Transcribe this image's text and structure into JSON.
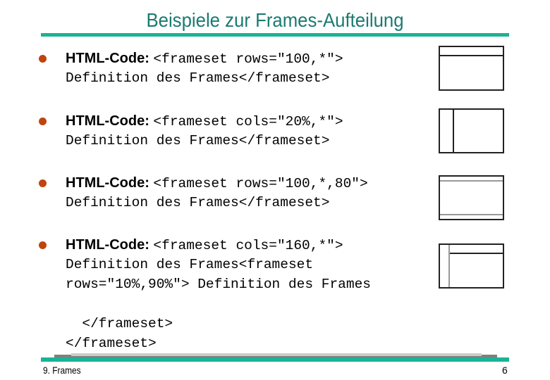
{
  "title": "Beispiele zur Frames-Aufteilung",
  "items": [
    {
      "label": "HTML-Code:",
      "code": "<frameset rows=\"100,*\">",
      "continuation": [
        "Definition des Frames</frameset>"
      ],
      "diagram": "rows-100-star"
    },
    {
      "label": "HTML-Code:",
      "code": "<frameset cols=\"20%,*\">",
      "continuation": [
        "Definition des Frames</frameset>"
      ],
      "diagram": "cols-20pct-star"
    },
    {
      "label": "HTML-Code:",
      "code": "<frameset rows=\"100,*,80\">",
      "continuation": [
        "Definition des Frames</frameset>"
      ],
      "diagram": "rows-100-star-80"
    },
    {
      "label": "HTML-Code:",
      "code": "<frameset cols=\"160,*\">",
      "continuation": [
        "Definition des Frames<frameset",
        "rows=\"10%,90%\"> Definition des Frames",
        "",
        "  </frameset>",
        "</frameset>"
      ],
      "diagram": "cols-160-star-nested-rows"
    }
  ],
  "footer": {
    "chapter": "9. Frames",
    "page": "6"
  },
  "colors": {
    "title": "#1a7a72",
    "accent_rule": "#1ab394",
    "bullet": "#c0440e"
  }
}
